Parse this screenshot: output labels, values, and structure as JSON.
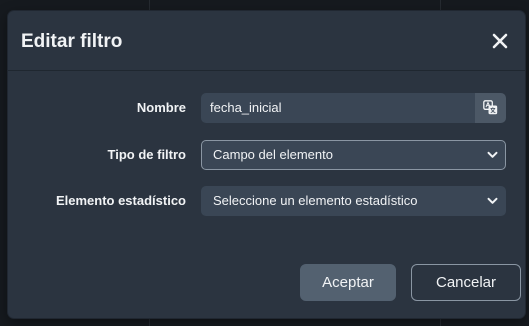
{
  "dialog": {
    "title": "Editar filtro"
  },
  "form": {
    "name": {
      "label": "Nombre",
      "value": "fecha_inicial"
    },
    "filter_type": {
      "label": "Tipo de filtro",
      "selected": "Campo del elemento"
    },
    "statistic_element": {
      "label": "Elemento estadístico",
      "selected": "Seleccione un elemento estadístico"
    }
  },
  "footer": {
    "accept_label": "Aceptar",
    "cancel_label": "Cancelar"
  },
  "icons": {
    "close": "close-icon",
    "translate": "translate-icon",
    "dropdown": "chevron-down-icon"
  }
}
